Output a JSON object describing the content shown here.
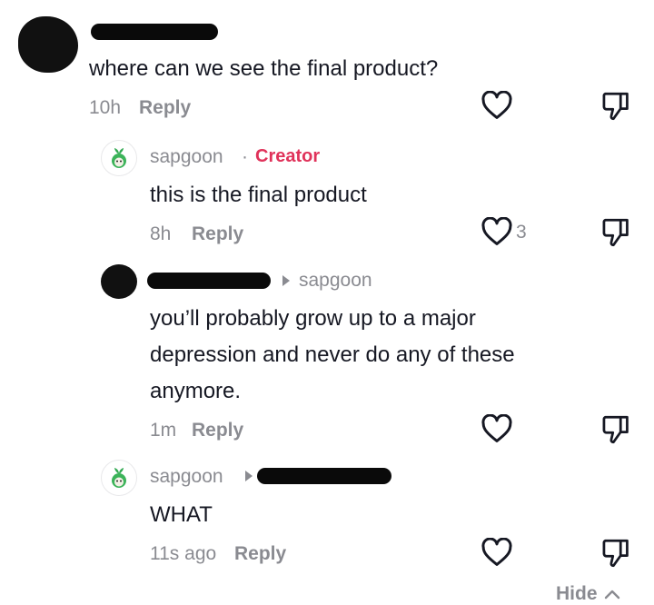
{
  "comment_1": {
    "text": "where can we see the final product?",
    "time": "10h",
    "reply_label": "Reply"
  },
  "reply_1": {
    "username": "sapgoon",
    "separator": "·",
    "creator_badge": "Creator",
    "text": "this is the final product",
    "time": "8h",
    "reply_label": "Reply",
    "like_count": "3"
  },
  "reply_2": {
    "reply_to": "sapgoon",
    "text_lines": [
      "you’ll probably grow up to a major",
      "depression and never do any of these",
      "anymore."
    ],
    "time": "1m",
    "reply_label": "Reply"
  },
  "reply_3": {
    "username": "sapgoon",
    "text": "WHAT",
    "time": "11s ago",
    "reply_label": "Reply"
  },
  "footer": {
    "hide_label": "Hide"
  },
  "icons": {
    "like": "heart-outline-icon",
    "dislike": "thumbs-down-icon",
    "caret": "caret-right-icon",
    "hide": "chevron-up-icon"
  },
  "colors": {
    "text": "#161823",
    "muted": "#8a8b91",
    "creator": "#e0325a"
  }
}
